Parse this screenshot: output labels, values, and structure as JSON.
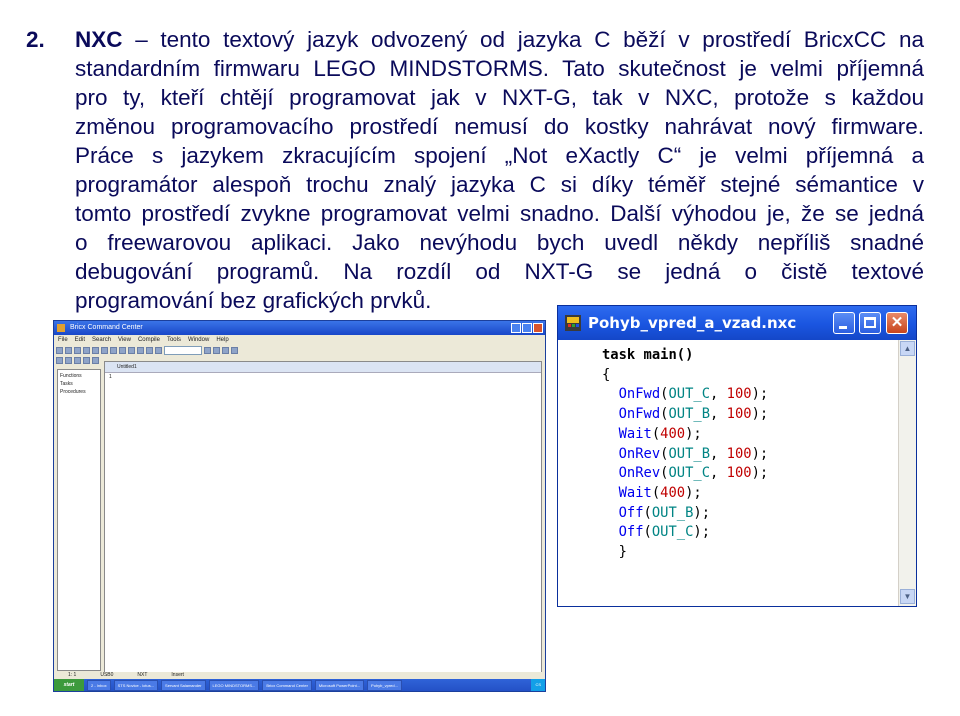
{
  "slide": {
    "number": "2.",
    "lines": [
      {
        "bold": "NXC",
        "text": " – tento textový jazyk odvozený od jazyka C běží v prostředí BricxCC na"
      },
      {
        "text": "standardním firmwaru LEGO MINDSTORMS. Tato skutečnost je velmi příjemná"
      },
      {
        "text": "pro ty, kteří chtějí programovat jak v NXT-G, tak v NXC, protože s každou"
      },
      {
        "text": "změnou programovacího prostředí nemusí do kostky nahrávat nový firmware."
      },
      {
        "text": "Práce s jazykem zkracujícím spojení „Not eXactly C“ je velmi příjemná a"
      },
      {
        "text": "programátor alespoň trochu znalý jazyka C si díky téměř stejné sémantice v"
      },
      {
        "text": "tomto prostředí zvykne programovat velmi snadno. Další výhodou je, že se jedná"
      },
      {
        "text": "o freewarovou aplikaci. Jako nevýhodu bych uvedl někdy nepříliš snadné"
      },
      {
        "text": "debugování programů. Na rozdíl od NXT-G se jedná o čistě textové"
      },
      {
        "text": "programování bez grafických prvků."
      }
    ]
  },
  "bricx": {
    "title": "Bricx Command Center",
    "menu": [
      "File",
      "Edit",
      "Search",
      "View",
      "Compile",
      "Tools",
      "Window",
      "Help"
    ],
    "tree": [
      "Functions",
      "Tasks",
      "Procedures"
    ],
    "tab": "Untitled1",
    "editor_text": "1",
    "status": [
      "1: 1",
      "USB0",
      "NXT",
      "Insert"
    ],
    "taskbar": {
      "start": "start",
      "buttons": [
        "2 - Inbox",
        "STS Novice - lotus...",
        "Servant Salamander",
        "LEGO MINDSTORMS...",
        "Bricx Command Center",
        "Microsoft PowerPoint...",
        "Pohyb_vpred..."
      ],
      "clock": "CS"
    }
  },
  "code_window": {
    "title": "Pohyb_vpred_a_vzad.nxc",
    "close_glyph": "✕",
    "code": [
      [
        {
          "t": "task main()",
          "c": "kw"
        }
      ],
      [
        {
          "t": "{",
          "c": ""
        }
      ],
      [
        {
          "t": "  ",
          "c": ""
        },
        {
          "t": "OnFwd",
          "c": "fn"
        },
        {
          "t": "(",
          "c": ""
        },
        {
          "t": "OUT_C",
          "c": "cst"
        },
        {
          "t": ", ",
          "c": ""
        },
        {
          "t": "100",
          "c": "nm"
        },
        {
          "t": ");",
          "c": ""
        }
      ],
      [
        {
          "t": "  ",
          "c": ""
        },
        {
          "t": "OnFwd",
          "c": "fn"
        },
        {
          "t": "(",
          "c": ""
        },
        {
          "t": "OUT_B",
          "c": "cst"
        },
        {
          "t": ", ",
          "c": ""
        },
        {
          "t": "100",
          "c": "nm"
        },
        {
          "t": ");",
          "c": ""
        }
      ],
      [
        {
          "t": "  ",
          "c": ""
        },
        {
          "t": "Wait",
          "c": "fn"
        },
        {
          "t": "(",
          "c": ""
        },
        {
          "t": "400",
          "c": "nm"
        },
        {
          "t": ");",
          "c": ""
        }
      ],
      [
        {
          "t": "  ",
          "c": ""
        },
        {
          "t": "OnRev",
          "c": "fn"
        },
        {
          "t": "(",
          "c": ""
        },
        {
          "t": "OUT_B",
          "c": "cst"
        },
        {
          "t": ", ",
          "c": ""
        },
        {
          "t": "100",
          "c": "nm"
        },
        {
          "t": ");",
          "c": ""
        }
      ],
      [
        {
          "t": "  ",
          "c": ""
        },
        {
          "t": "OnRev",
          "c": "fn"
        },
        {
          "t": "(",
          "c": ""
        },
        {
          "t": "OUT_C",
          "c": "cst"
        },
        {
          "t": ", ",
          "c": ""
        },
        {
          "t": "100",
          "c": "nm"
        },
        {
          "t": ");",
          "c": ""
        }
      ],
      [
        {
          "t": "  ",
          "c": ""
        },
        {
          "t": "Wait",
          "c": "fn"
        },
        {
          "t": "(",
          "c": ""
        },
        {
          "t": "400",
          "c": "nm"
        },
        {
          "t": ");",
          "c": ""
        }
      ],
      [
        {
          "t": "  ",
          "c": ""
        },
        {
          "t": "Off",
          "c": "fn"
        },
        {
          "t": "(",
          "c": ""
        },
        {
          "t": "OUT_B",
          "c": "cst"
        },
        {
          "t": ");",
          "c": ""
        }
      ],
      [
        {
          "t": "  ",
          "c": ""
        },
        {
          "t": "Off",
          "c": "fn"
        },
        {
          "t": "(",
          "c": ""
        },
        {
          "t": "OUT_C",
          "c": "cst"
        },
        {
          "t": ");",
          "c": ""
        }
      ],
      [
        {
          "t": "  }",
          "c": ""
        }
      ]
    ]
  },
  "colors": {
    "text": "#0a0a5a",
    "function": "#0000ee",
    "constant": "#008484",
    "number": "#c00000"
  }
}
